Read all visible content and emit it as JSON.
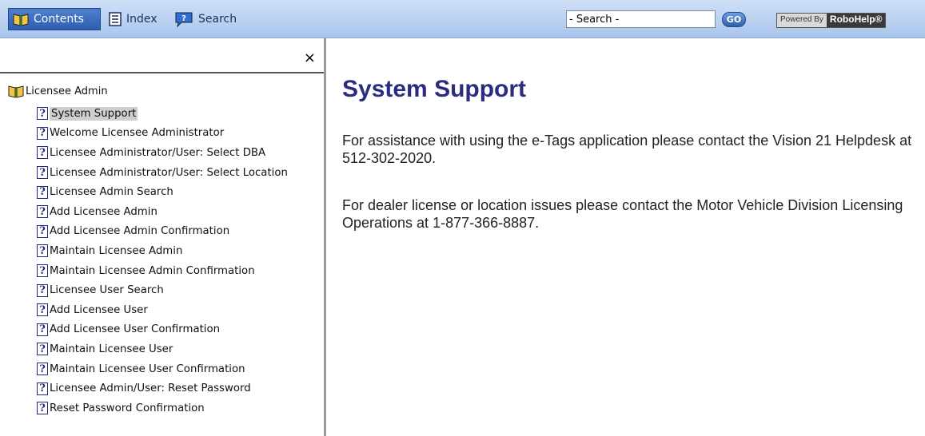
{
  "toolbar": {
    "tabs": [
      {
        "label": "Contents",
        "icon": "book-icon",
        "active": true
      },
      {
        "label": "Index",
        "icon": "index-list-icon",
        "active": false
      },
      {
        "label": "Search",
        "icon": "speech-bubble-icon",
        "active": false
      }
    ],
    "search_value": "- Search -",
    "go_label": "GO",
    "powered_by": "Powered By",
    "brand": "RoboHelp®"
  },
  "left_pane": {
    "close_label": "×",
    "root": {
      "label": "Licensee Admin",
      "icon": "open-book-icon"
    },
    "items": [
      {
        "label": "System Support",
        "selected": true
      },
      {
        "label": "Welcome Licensee Administrator"
      },
      {
        "label": "Licensee Administrator/User: Select DBA"
      },
      {
        "label": "Licensee Administrator/User: Select Location"
      },
      {
        "label": "Licensee Admin Search"
      },
      {
        "label": "Add Licensee Admin"
      },
      {
        "label": "Add Licensee Admin Confirmation"
      },
      {
        "label": "Maintain Licensee Admin"
      },
      {
        "label": "Maintain Licensee Admin Confirmation"
      },
      {
        "label": "Licensee User Search"
      },
      {
        "label": "Add Licensee User"
      },
      {
        "label": "Add Licensee User Confirmation"
      },
      {
        "label": "Maintain Licensee User"
      },
      {
        "label": "Maintain Licensee User Confirmation"
      },
      {
        "label": "Licensee Admin/User: Reset Password"
      },
      {
        "label": "Reset Password Confirmation"
      }
    ]
  },
  "content": {
    "title": "System Support",
    "paragraphs": [
      "For assistance with using the e-Tags application please contact the Vision 21 Helpdesk at 512-302-2020.",
      "For dealer license or location issues please contact the Motor Vehicle Division Licensing Operations at 1-877-366-8887."
    ]
  },
  "colors": {
    "toolbar_top": "#cfe0f6",
    "toolbar_bottom": "#a9c5ec",
    "title": "#2b2b82",
    "selected_bg": "#cfcfcf"
  }
}
